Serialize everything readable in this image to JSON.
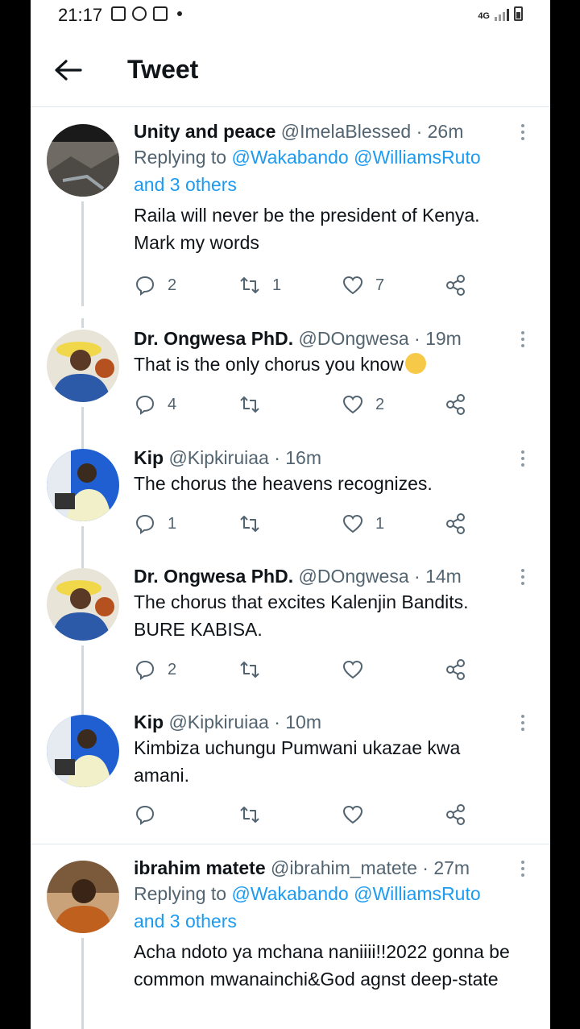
{
  "status": {
    "time": "21:17",
    "network": "4G"
  },
  "header": {
    "title": "Tweet"
  },
  "tweets": [
    {
      "name": "Unity and peace",
      "handle": "@ImelaBlessed",
      "time": "· 26m",
      "replying_prefix": "Replying to ",
      "replying_mentions": "@Wakabando @WilliamsRuto",
      "replying_more": "and 3 others",
      "text": "Raila will never be the president of Kenya. Mark my words",
      "replies": "2",
      "retweets": "1",
      "likes": "7"
    },
    {
      "name": "Dr. Ongwesa PhD.",
      "handle": "@DOngwesa",
      "time": "· 19m",
      "text": "That is the only chorus you know",
      "replies": "4",
      "retweets": "",
      "likes": "2"
    },
    {
      "name": "Kip",
      "handle": "@Kipkiruiaa",
      "time": "· 16m",
      "text": "The chorus the heavens recognizes.",
      "replies": "1",
      "retweets": "",
      "likes": "1"
    },
    {
      "name": "Dr. Ongwesa PhD.",
      "handle": "@DOngwesa",
      "time": "· 14m",
      "text": "The chorus that excites Kalenjin Bandits. BURE KABISA.",
      "replies": "2",
      "retweets": "",
      "likes": ""
    },
    {
      "name": "Kip",
      "handle": "@Kipkiruiaa",
      "time": "· 10m",
      "text": "Kimbiza uchungu Pumwani ukazae kwa amani.",
      "replies": "",
      "retweets": "",
      "likes": ""
    },
    {
      "name": "ibrahim matete",
      "handle": "@ibrahim_matete",
      "time": "· 27m",
      "replying_prefix": "Replying to ",
      "replying_mentions": "@Wakabando @WilliamsRuto",
      "replying_more": "and 3 others",
      "text": "Acha ndoto ya mchana naniiii!!2022 gonna be common mwanainchi&God agnst deep-state"
    }
  ]
}
